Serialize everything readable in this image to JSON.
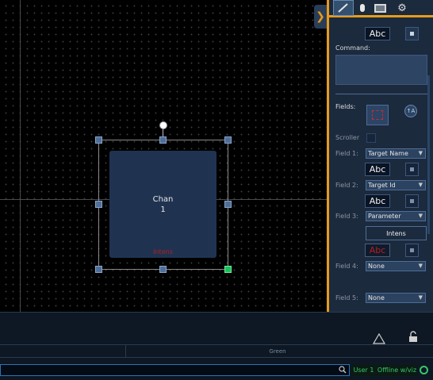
{
  "canvas": {
    "tile": {
      "title": "Chan",
      "number": "1",
      "sublabel": "Intens"
    }
  },
  "panel": {
    "tools": [
      "pencil-icon",
      "mouse-icon",
      "image-icon",
      "gears-icon"
    ],
    "command_label": "Command:",
    "fields_label": "Fields:",
    "scroller_label": "Scroller",
    "abc_text": "Abc",
    "field1": {
      "label": "Field 1:",
      "value": "Target Name"
    },
    "field2": {
      "label": "Field 2:",
      "value": "Target Id"
    },
    "field3": {
      "label": "Field 3:",
      "value": "Parameter"
    },
    "field3_param": "Intens",
    "field4": {
      "label": "Field 4:",
      "value": "None"
    },
    "field5": {
      "label": "Field 5:",
      "value": "None"
    }
  },
  "bottom": {
    "strip_label": "Green",
    "user": "User 1",
    "status": "Offline w/viz"
  },
  "colors": {
    "accent": "#e79b1c",
    "tile": "#1f3351",
    "active_handle": "#19c35a",
    "status_green": "#38c767"
  }
}
